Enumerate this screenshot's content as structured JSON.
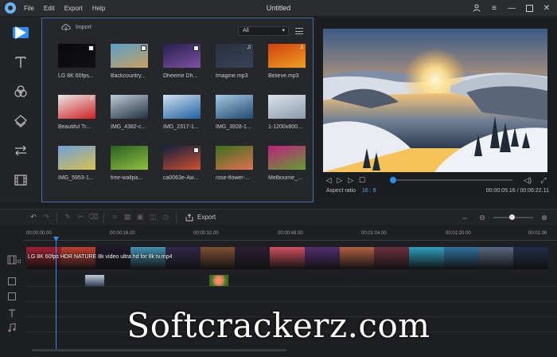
{
  "window": {
    "title": "Untitled",
    "menu": [
      "File",
      "Edit",
      "Export",
      "Help"
    ]
  },
  "sidebar": {
    "items": [
      {
        "name": "media-tab",
        "icon": "video-icon",
        "active": true
      },
      {
        "name": "text-tab",
        "icon": "text-icon"
      },
      {
        "name": "filters-tab",
        "icon": "filters-icon"
      },
      {
        "name": "overlays-tab",
        "icon": "layers-icon"
      },
      {
        "name": "transitions-tab",
        "icon": "transition-icon"
      },
      {
        "name": "elements-tab",
        "icon": "film-icon"
      }
    ]
  },
  "media": {
    "import_label": "Import",
    "filter_value": "All",
    "items": [
      {
        "label": "LG 8K 60fps...",
        "badge": "video",
        "colors": [
          "#0a0a0c",
          "#101016"
        ]
      },
      {
        "label": "Backcountry...",
        "badge": "video",
        "colors": [
          "#5aa0c8",
          "#c8a060"
        ]
      },
      {
        "label": "Dheeme Dh...",
        "badge": "video",
        "colors": [
          "#242050",
          "#8050a0"
        ]
      },
      {
        "label": "Imagine.mp3",
        "badge": "music",
        "colors": [
          "#2a3040",
          "#3a4258"
        ]
      },
      {
        "label": "Believe.mp3",
        "badge": "music",
        "colors": [
          "#d04010",
          "#f0a020"
        ]
      },
      {
        "label": "Beautiful Tr...",
        "badge": "music",
        "colors": [
          "#e8e8e8",
          "#d02020"
        ]
      },
      {
        "label": "IMG_4382-c...",
        "badge": "",
        "colors": [
          "#c0ccd8",
          "#203040"
        ]
      },
      {
        "label": "IMG_2317-1...",
        "badge": "",
        "colors": [
          "#d0e0f0",
          "#2060a0"
        ]
      },
      {
        "label": "IMG_3928-1...",
        "badge": "",
        "colors": [
          "#a8c8e0",
          "#204a70"
        ]
      },
      {
        "label": "1-1200x800...",
        "badge": "",
        "colors": [
          "#dce4ec",
          "#8a9aaa"
        ]
      },
      {
        "label": "IMG_5953-1...",
        "badge": "",
        "colors": [
          "#70a0d8",
          "#d8c050"
        ]
      },
      {
        "label": "free-wallpa...",
        "badge": "",
        "colors": [
          "#2a6020",
          "#90c040"
        ]
      },
      {
        "label": "ca0063e-Aw...",
        "badge": "video",
        "colors": [
          "#102040",
          "#d05030"
        ]
      },
      {
        "label": "rose-flower-...",
        "badge": "",
        "colors": [
          "#3a7020",
          "#e07050"
        ]
      },
      {
        "label": "Melbourne_...",
        "badge": "",
        "colors": [
          "#c02080",
          "#60a030"
        ]
      }
    ]
  },
  "preview": {
    "aspect_label": "Aspect ratio",
    "aspect_value": "16 : 9",
    "time_current": "00:00:05.16",
    "time_total": "00:06:22.11",
    "timecode": "00:00:05.16 / 00:06:22.11",
    "progress": 0.013
  },
  "toolbar": {
    "export_label": "Export",
    "zoom": 0.45
  },
  "timeline": {
    "ruler_labels": [
      "00:00:00.00",
      "00:00:16.00",
      "00:00:32.00",
      "00:00:48.00",
      "00:01:04.00",
      "00:01:20.00",
      "00:01:36"
    ],
    "clip_label": "LG 8K 60fps HDR NATURE 8k video ultra hd for 8k tv.mp4",
    "clip_colors": [
      "#203048",
      "#5a6a80",
      "#3070a0",
      "#30a0c0",
      "#6a3040",
      "#b06040",
      "#503070",
      "#d05060",
      "#2a2030",
      "#805030",
      "#302848",
      "#4090b0",
      "#201828",
      "#c04030",
      "#a02030"
    ]
  },
  "watermark": "Softcrackerz.com"
}
